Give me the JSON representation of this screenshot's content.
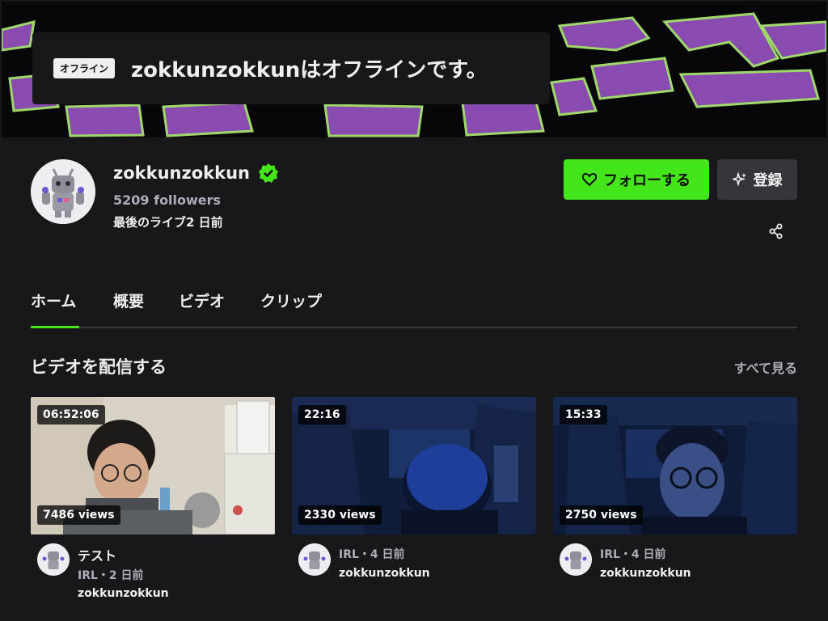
{
  "banner": {
    "offline_badge": "オフライン",
    "offline_message": "zokkunzokkunはオフラインです。"
  },
  "channel": {
    "name": "zokkunzokkun",
    "followers": "5209 followers",
    "last_live": "最後のライブ2 日前",
    "follow_label": "フォローする",
    "subscribe_label": "登録"
  },
  "tabs": [
    {
      "label": "ホーム",
      "active": true
    },
    {
      "label": "概要"
    },
    {
      "label": "ビデオ"
    },
    {
      "label": "クリップ"
    }
  ],
  "section": {
    "title": "ビデオを配信する",
    "see_all": "すべて見る"
  },
  "videos": [
    {
      "duration": "06:52:06",
      "views": "7486 views",
      "title": "テスト",
      "meta": "IRL・2 日前",
      "user": "zokkunzokkun"
    },
    {
      "duration": "22:16",
      "views": "2330 views",
      "title": "",
      "meta": "IRL・4 日前",
      "user": "zokkunzokkun"
    },
    {
      "duration": "15:33",
      "views": "2750 views",
      "title": "",
      "meta": "IRL・4 日前",
      "user": "zokkunzokkun"
    }
  ],
  "colors": {
    "accent_green": "#45e51b",
    "background": "#18181b",
    "muted_text": "#adadb8",
    "banner_purple": "#8a4bb0",
    "banner_green": "#9fd86a"
  },
  "icons": {
    "verified": "verified-badge-icon",
    "follow": "heart-icon",
    "subscribe": "sparkle-icon",
    "share": "share-icon"
  }
}
